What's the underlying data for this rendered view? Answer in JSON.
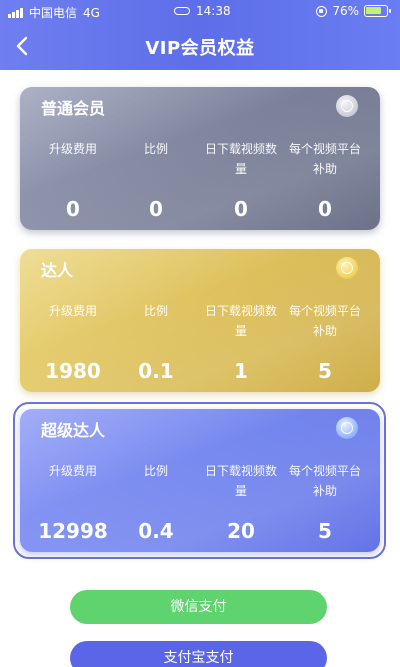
{
  "status_bar": {
    "carrier": "中国电信",
    "network": "4G",
    "time": "14:38",
    "battery": "76%",
    "icons": [
      "signal-icon",
      "link-icon",
      "orientation-lock-icon",
      "battery-icon"
    ]
  },
  "header": {
    "title": "VIP会员权益",
    "back_icon": "chevron-left-icon"
  },
  "colors": {
    "header": "#6474ee",
    "card_normal": "#7b8199",
    "card_talent": "#dcbf5a",
    "card_super": "#7386ee",
    "wechat_button": "#5fd36e",
    "alipay_button": "#5a65e8"
  },
  "tiers": [
    {
      "name": "普通会员",
      "badge_icon": "silver-medal-icon",
      "labels": [
        "升级费用",
        "比例",
        "日下载视频数量",
        "每个视频平台补助"
      ],
      "values": [
        "0",
        "0",
        "0",
        "0"
      ]
    },
    {
      "name": "达人",
      "badge_icon": "gold-medal-icon",
      "labels": [
        "升级费用",
        "比例",
        "日下载视频数量",
        "每个视频平台补助"
      ],
      "values": [
        "1980",
        "0.1",
        "1",
        "5"
      ]
    },
    {
      "name": "超级达人",
      "badge_icon": "blue-medal-icon",
      "labels": [
        "升级费用",
        "比例",
        "日下载视频数量",
        "每个视频平台补助"
      ],
      "values": [
        "12998",
        "0.4",
        "20",
        "5"
      ],
      "selected": true
    }
  ],
  "buttons": {
    "wechat_pay": "微信支付",
    "alipay": "支付宝支付"
  }
}
